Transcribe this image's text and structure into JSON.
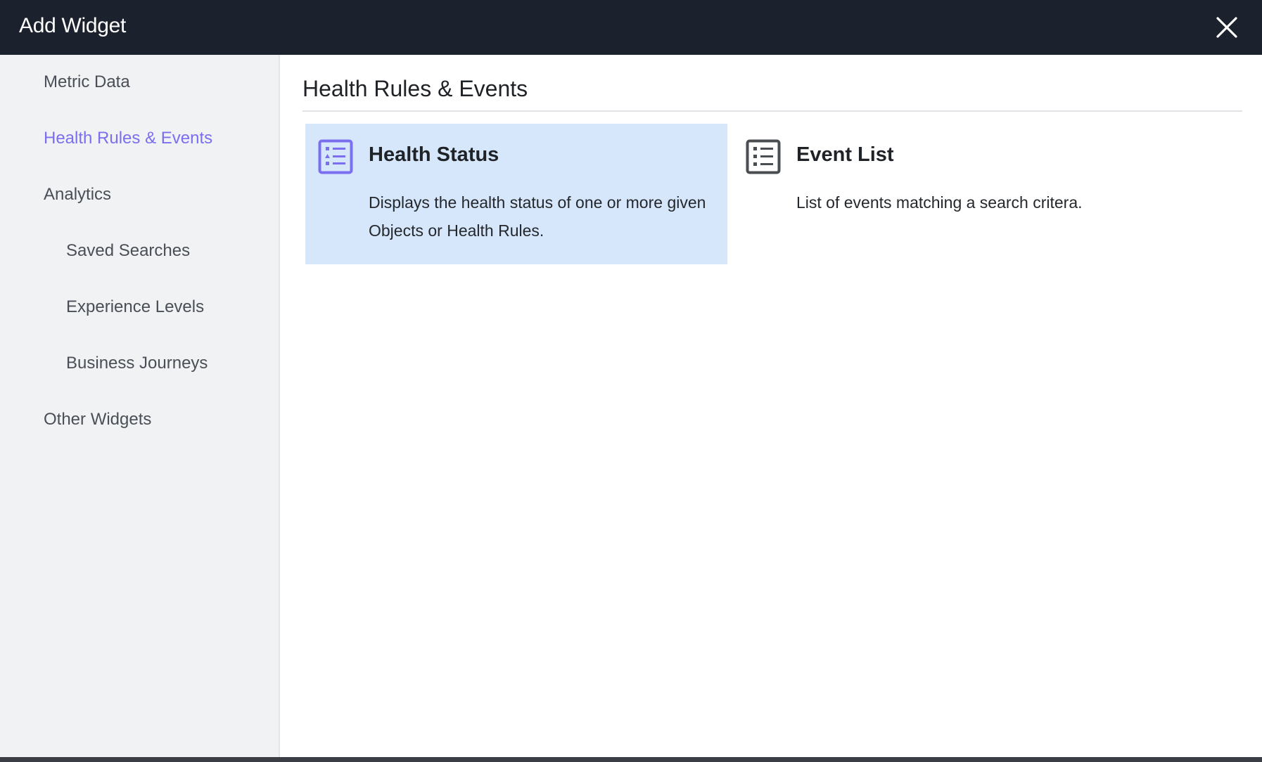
{
  "dialog": {
    "title": "Add Widget",
    "close_icon": "close-icon"
  },
  "sidebar": {
    "items": [
      {
        "label": "Metric Data",
        "active": false,
        "indent": false
      },
      {
        "label": "Health Rules & Events",
        "active": true,
        "indent": false
      },
      {
        "label": "Analytics",
        "active": false,
        "indent": false
      },
      {
        "label": "Saved Searches",
        "active": false,
        "indent": true
      },
      {
        "label": "Experience Levels",
        "active": false,
        "indent": true
      },
      {
        "label": "Business Journeys",
        "active": false,
        "indent": true
      },
      {
        "label": "Other Widgets",
        "active": false,
        "indent": false
      }
    ]
  },
  "main": {
    "section_title": "Health Rules & Events",
    "widgets": [
      {
        "title": "Health Status",
        "description": "Displays the health status of one or more given Objects or Health Rules.",
        "icon": "health-status-list-icon",
        "selected": true
      },
      {
        "title": "Event List",
        "description": "List of events matching a search critera.",
        "icon": "event-list-icon",
        "selected": false
      }
    ]
  },
  "colors": {
    "titlebar": "#1c222d",
    "sidebar_bg": "#f1f2f4",
    "active_accent": "#7b6ff0",
    "selected_card_bg": "#d6e7fb",
    "icon_gray": "#4a4d52"
  }
}
